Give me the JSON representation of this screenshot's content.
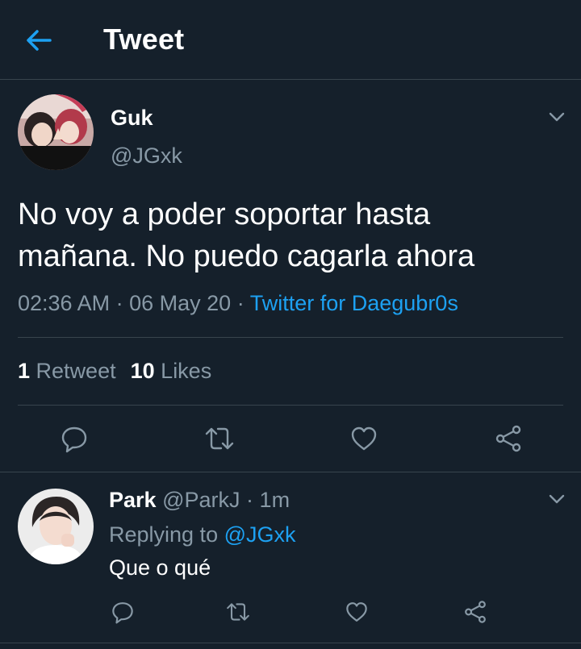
{
  "header": {
    "title": "Tweet"
  },
  "tweet": {
    "name": "Guk",
    "handle": "@JGxk",
    "text_line1": "No voy a poder soportar hasta",
    "text_line2": "mañana. No puedo cagarla ahora",
    "time": "02:36 AM",
    "sep": "·",
    "date": "06 May 20",
    "source": "Twitter for Daegubr0s",
    "retweet_count": "1",
    "retweet_label": "Retweet",
    "like_count": "10",
    "like_label": "Likes"
  },
  "reply": {
    "name": "Park",
    "handle": "@ParkJ",
    "sep": "·",
    "time": "1m",
    "replying_prefix": "Replying to",
    "replying_to": "@JGxk",
    "text": "Que o qué"
  },
  "colors": {
    "background": "#15202b",
    "accent": "#1da1f2",
    "secondary_text": "#8899a6",
    "divider": "#38444d"
  },
  "icons": {
    "back": "arrow-left-icon",
    "menu": "chevron-down-icon",
    "reply": "speech-bubble-icon",
    "retweet": "retweet-icon",
    "like": "heart-icon",
    "share": "share-icon"
  }
}
